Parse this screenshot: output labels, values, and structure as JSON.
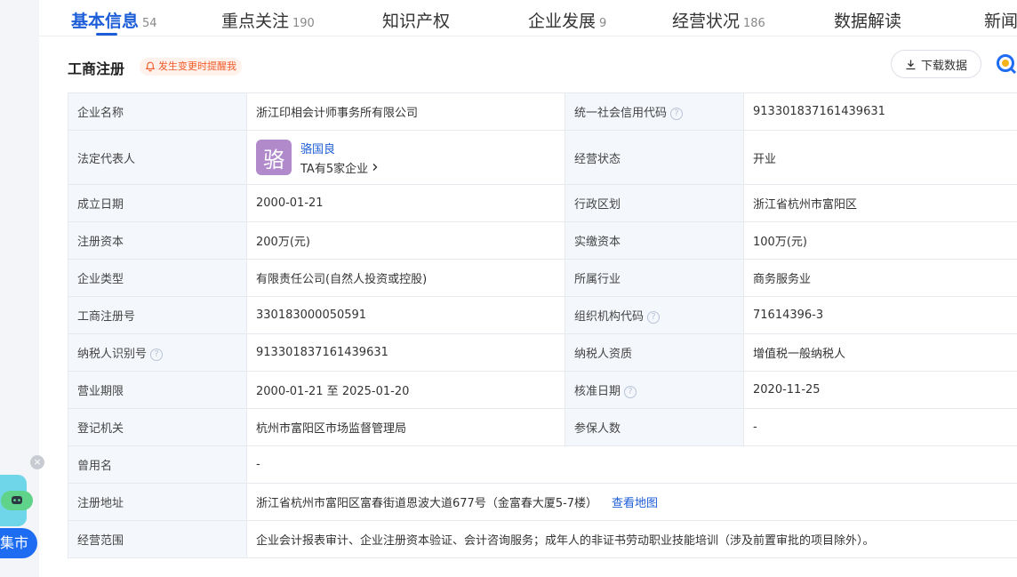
{
  "tabs": [
    {
      "label": "基本信息",
      "count": "54"
    },
    {
      "label": "重点关注",
      "count": "190"
    },
    {
      "label": "知识产权",
      "count": ""
    },
    {
      "label": "企业发展",
      "count": "9"
    },
    {
      "label": "经营状况",
      "count": "186"
    },
    {
      "label": "数据解读",
      "count": ""
    },
    {
      "label": "新闻",
      "count": ""
    }
  ],
  "section": {
    "title": "工商注册",
    "remind_label": "发生变更时提醒我",
    "download_label": "下载数据"
  },
  "legal": {
    "avatar_char": "骆",
    "name": "骆国良",
    "sub": "TA有5家企业"
  },
  "rows": [
    {
      "l1": "企业名称",
      "v1": "浙江印相会计师事务所有限公司",
      "l2": "统一社会信用代码",
      "v2": "913301837161439631"
    },
    {
      "l1": "法定代表人",
      "l2": "经营状态",
      "v2": "开业"
    },
    {
      "l1": "成立日期",
      "v1": "2000-01-21",
      "l2": "行政区划",
      "v2": "浙江省杭州市富阳区"
    },
    {
      "l1": "注册资本",
      "v1": "200万(元)",
      "l2": "实缴资本",
      "v2": "100万(元)"
    },
    {
      "l1": "企业类型",
      "v1": "有限责任公司(自然人投资或控股)",
      "l2": "所属行业",
      "v2": "商务服务业"
    },
    {
      "l1": "工商注册号",
      "v1": "330183000050591",
      "l2": "组织机构代码",
      "v2": "71614396-3"
    },
    {
      "l1": "纳税人识别号",
      "v1": "913301837161439631",
      "l2": "纳税人资质",
      "v2": "增值税一般纳税人"
    },
    {
      "l1": "营业期限",
      "v1": "2000-01-21 至 2025-01-20",
      "l2": "核准日期",
      "v2": "2020-11-25"
    },
    {
      "l1": "登记机关",
      "v1": "杭州市富阳区市场监督管理局",
      "l2": "参保人数",
      "v2": "-"
    },
    {
      "l1": "曾用名",
      "v1": "-"
    },
    {
      "l1": "注册地址",
      "v1": "浙江省杭州市富阳区富春街道恩波大道677号（金富春大厦5-7楼）",
      "link": "查看地图"
    },
    {
      "l1": "经营范围",
      "v1": "企业会计报表审计、企业注册资本验证、会计咨询服务；成年人的非证书劳动职业技能培训（涉及前置审批的项目除外）。"
    }
  ],
  "help_glyph": "?",
  "float": {
    "close_glyph": "×",
    "market_label": "集市"
  },
  "colors": {
    "accent": "#1d5ed8",
    "remind": "#f05a28",
    "label_bg": "#f4f7fc",
    "avatar": "#b08acb"
  }
}
